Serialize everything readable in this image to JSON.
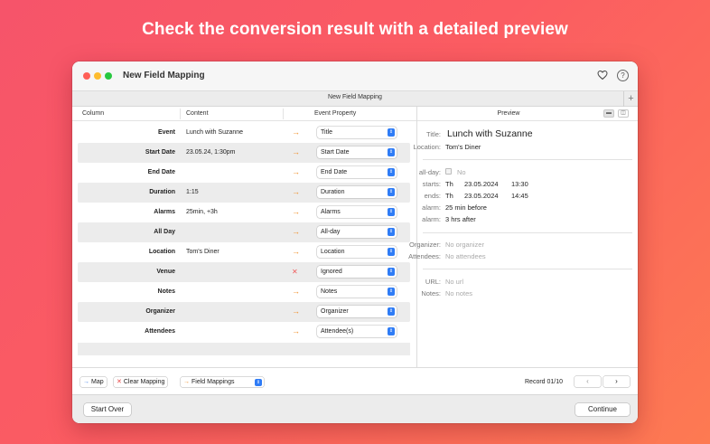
{
  "headline": "Check the conversion result with a detailed preview",
  "window": {
    "title": "New Field Mapping",
    "heart_icon": "heart-icon",
    "help_icon": "help-icon",
    "help_glyph": "?"
  },
  "tabbar": {
    "tab_label": "New Field Mapping",
    "add_label": "+"
  },
  "mapping": {
    "headers": {
      "column": "Column",
      "content": "Content",
      "property": "Event Property"
    },
    "rows": [
      {
        "column": "Event",
        "content": "Lunch with Suzanne",
        "arrow": "→",
        "property": "Title",
        "ignored": false
      },
      {
        "column": "Start Date",
        "content": "23.05.24, 1:30pm",
        "arrow": "→",
        "property": "Start Date",
        "ignored": false
      },
      {
        "column": "End Date",
        "content": "",
        "arrow": "→",
        "property": "End Date",
        "ignored": false
      },
      {
        "column": "Duration",
        "content": "1:15",
        "arrow": "→",
        "property": "Duration",
        "ignored": false
      },
      {
        "column": "Alarms",
        "content": "25min, +3h",
        "arrow": "→",
        "property": "Alarms",
        "ignored": false
      },
      {
        "column": "All Day",
        "content": "",
        "arrow": "→",
        "property": "All-day",
        "ignored": false
      },
      {
        "column": "Location",
        "content": "Tom's Diner",
        "arrow": "→",
        "property": "Location",
        "ignored": false
      },
      {
        "column": "Venue",
        "content": "",
        "arrow": "✕",
        "property": "Ignored",
        "ignored": true
      },
      {
        "column": "Notes",
        "content": "",
        "arrow": "→",
        "property": "Notes",
        "ignored": false
      },
      {
        "column": "Organizer",
        "content": "",
        "arrow": "→",
        "property": "Organizer",
        "ignored": false
      },
      {
        "column": "Attendees",
        "content": "",
        "arrow": "→",
        "property": "Attendee(s)",
        "ignored": false
      }
    ],
    "select_glyph": "⇕"
  },
  "preview": {
    "header": "Preview",
    "title_label": "Title:",
    "title_value": "Lunch with Suzanne",
    "location_label": "Location:",
    "location_value": "Tom's Diner",
    "allday_label": "all-day:",
    "allday_value": "No",
    "starts_label": "starts:",
    "starts_day": "Th",
    "starts_date": "23.05.2024",
    "starts_time": "13:30",
    "ends_label": "ends:",
    "ends_day": "Th",
    "ends_date": "23.05.2024",
    "ends_time": "14:45",
    "alarm1_label": "alarm:",
    "alarm1_value": "25 min before",
    "alarm2_label": "alarm:",
    "alarm2_value": "3 hrs after",
    "organizer_label": "Organizer:",
    "organizer_value": "No organizer",
    "attendees_label": "Attendees:",
    "attendees_value": "No attendees",
    "url_label": "URL:",
    "url_value": "No url",
    "notes_label": "Notes:",
    "notes_value": "No notes"
  },
  "bottom": {
    "map_label": "Map",
    "clear_label": "Clear Mapping",
    "mappings_label": "Field Mappings",
    "record_label": "Record 01/10",
    "prev_glyph": "‹",
    "next_glyph": "›"
  },
  "footer": {
    "start_over": "Start Over",
    "continue": "Continue"
  },
  "colors": {
    "accent_blue": "#2f7cf6",
    "arrow_orange": "#f0902a",
    "ignored_red": "#f05a5a",
    "background_start": "#f6546a",
    "background_end": "#fd7a52"
  }
}
